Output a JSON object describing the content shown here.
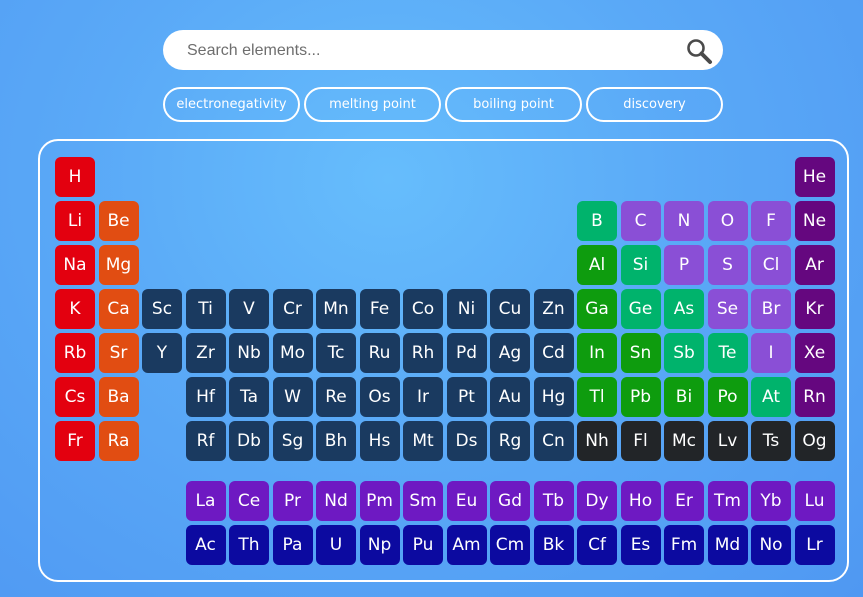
{
  "search": {
    "placeholder": "Search elements..."
  },
  "filters": [
    {
      "label": "electronegativity"
    },
    {
      "label": "melting point"
    },
    {
      "label": "boiling point"
    },
    {
      "label": "discovery"
    }
  ],
  "colors": {
    "alkali": "#e3000f",
    "alkaline_earth": "#e14d12",
    "transition": "#1a3a60",
    "post_transition": "#0e9c0e",
    "metalloid": "#00b36c",
    "nonmetal": "#8a4fd6",
    "noble_gas": "#65077f",
    "unknown": "#222528",
    "lanthanide": "#6e19c2",
    "actinide": "#0c0aa0"
  },
  "elements": [
    {
      "symbol": "H",
      "row": 1,
      "col": 1,
      "category": "alkali"
    },
    {
      "symbol": "He",
      "row": 1,
      "col": 18,
      "category": "noble_gas"
    },
    {
      "symbol": "Li",
      "row": 2,
      "col": 1,
      "category": "alkali"
    },
    {
      "symbol": "Be",
      "row": 2,
      "col": 2,
      "category": "alkaline_earth"
    },
    {
      "symbol": "B",
      "row": 2,
      "col": 13,
      "category": "metalloid"
    },
    {
      "symbol": "C",
      "row": 2,
      "col": 14,
      "category": "nonmetal"
    },
    {
      "symbol": "N",
      "row": 2,
      "col": 15,
      "category": "nonmetal"
    },
    {
      "symbol": "O",
      "row": 2,
      "col": 16,
      "category": "nonmetal"
    },
    {
      "symbol": "F",
      "row": 2,
      "col": 17,
      "category": "nonmetal"
    },
    {
      "symbol": "Ne",
      "row": 2,
      "col": 18,
      "category": "noble_gas"
    },
    {
      "symbol": "Na",
      "row": 3,
      "col": 1,
      "category": "alkali"
    },
    {
      "symbol": "Mg",
      "row": 3,
      "col": 2,
      "category": "alkaline_earth"
    },
    {
      "symbol": "Al",
      "row": 3,
      "col": 13,
      "category": "post_transition"
    },
    {
      "symbol": "Si",
      "row": 3,
      "col": 14,
      "category": "metalloid"
    },
    {
      "symbol": "P",
      "row": 3,
      "col": 15,
      "category": "nonmetal"
    },
    {
      "symbol": "S",
      "row": 3,
      "col": 16,
      "category": "nonmetal"
    },
    {
      "symbol": "Cl",
      "row": 3,
      "col": 17,
      "category": "nonmetal"
    },
    {
      "symbol": "Ar",
      "row": 3,
      "col": 18,
      "category": "noble_gas"
    },
    {
      "symbol": "K",
      "row": 4,
      "col": 1,
      "category": "alkali"
    },
    {
      "symbol": "Ca",
      "row": 4,
      "col": 2,
      "category": "alkaline_earth"
    },
    {
      "symbol": "Sc",
      "row": 4,
      "col": 3,
      "category": "transition"
    },
    {
      "symbol": "Ti",
      "row": 4,
      "col": 4,
      "category": "transition"
    },
    {
      "symbol": "V",
      "row": 4,
      "col": 5,
      "category": "transition"
    },
    {
      "symbol": "Cr",
      "row": 4,
      "col": 6,
      "category": "transition"
    },
    {
      "symbol": "Mn",
      "row": 4,
      "col": 7,
      "category": "transition"
    },
    {
      "symbol": "Fe",
      "row": 4,
      "col": 8,
      "category": "transition"
    },
    {
      "symbol": "Co",
      "row": 4,
      "col": 9,
      "category": "transition"
    },
    {
      "symbol": "Ni",
      "row": 4,
      "col": 10,
      "category": "transition"
    },
    {
      "symbol": "Cu",
      "row": 4,
      "col": 11,
      "category": "transition"
    },
    {
      "symbol": "Zn",
      "row": 4,
      "col": 12,
      "category": "transition"
    },
    {
      "symbol": "Ga",
      "row": 4,
      "col": 13,
      "category": "post_transition"
    },
    {
      "symbol": "Ge",
      "row": 4,
      "col": 14,
      "category": "metalloid"
    },
    {
      "symbol": "As",
      "row": 4,
      "col": 15,
      "category": "metalloid"
    },
    {
      "symbol": "Se",
      "row": 4,
      "col": 16,
      "category": "nonmetal"
    },
    {
      "symbol": "Br",
      "row": 4,
      "col": 17,
      "category": "nonmetal"
    },
    {
      "symbol": "Kr",
      "row": 4,
      "col": 18,
      "category": "noble_gas"
    },
    {
      "symbol": "Rb",
      "row": 5,
      "col": 1,
      "category": "alkali"
    },
    {
      "symbol": "Sr",
      "row": 5,
      "col": 2,
      "category": "alkaline_earth"
    },
    {
      "symbol": "Y",
      "row": 5,
      "col": 3,
      "category": "transition"
    },
    {
      "symbol": "Zr",
      "row": 5,
      "col": 4,
      "category": "transition"
    },
    {
      "symbol": "Nb",
      "row": 5,
      "col": 5,
      "category": "transition"
    },
    {
      "symbol": "Mo",
      "row": 5,
      "col": 6,
      "category": "transition"
    },
    {
      "symbol": "Tc",
      "row": 5,
      "col": 7,
      "category": "transition"
    },
    {
      "symbol": "Ru",
      "row": 5,
      "col": 8,
      "category": "transition"
    },
    {
      "symbol": "Rh",
      "row": 5,
      "col": 9,
      "category": "transition"
    },
    {
      "symbol": "Pd",
      "row": 5,
      "col": 10,
      "category": "transition"
    },
    {
      "symbol": "Ag",
      "row": 5,
      "col": 11,
      "category": "transition"
    },
    {
      "symbol": "Cd",
      "row": 5,
      "col": 12,
      "category": "transition"
    },
    {
      "symbol": "In",
      "row": 5,
      "col": 13,
      "category": "post_transition"
    },
    {
      "symbol": "Sn",
      "row": 5,
      "col": 14,
      "category": "post_transition"
    },
    {
      "symbol": "Sb",
      "row": 5,
      "col": 15,
      "category": "metalloid"
    },
    {
      "symbol": "Te",
      "row": 5,
      "col": 16,
      "category": "metalloid"
    },
    {
      "symbol": "I",
      "row": 5,
      "col": 17,
      "category": "nonmetal"
    },
    {
      "symbol": "Xe",
      "row": 5,
      "col": 18,
      "category": "noble_gas"
    },
    {
      "symbol": "Cs",
      "row": 6,
      "col": 1,
      "category": "alkali"
    },
    {
      "symbol": "Ba",
      "row": 6,
      "col": 2,
      "category": "alkaline_earth"
    },
    {
      "symbol": "Hf",
      "row": 6,
      "col": 4,
      "category": "transition"
    },
    {
      "symbol": "Ta",
      "row": 6,
      "col": 5,
      "category": "transition"
    },
    {
      "symbol": "W",
      "row": 6,
      "col": 6,
      "category": "transition"
    },
    {
      "symbol": "Re",
      "row": 6,
      "col": 7,
      "category": "transition"
    },
    {
      "symbol": "Os",
      "row": 6,
      "col": 8,
      "category": "transition"
    },
    {
      "symbol": "Ir",
      "row": 6,
      "col": 9,
      "category": "transition"
    },
    {
      "symbol": "Pt",
      "row": 6,
      "col": 10,
      "category": "transition"
    },
    {
      "symbol": "Au",
      "row": 6,
      "col": 11,
      "category": "transition"
    },
    {
      "symbol": "Hg",
      "row": 6,
      "col": 12,
      "category": "transition"
    },
    {
      "symbol": "Tl",
      "row": 6,
      "col": 13,
      "category": "post_transition"
    },
    {
      "symbol": "Pb",
      "row": 6,
      "col": 14,
      "category": "post_transition"
    },
    {
      "symbol": "Bi",
      "row": 6,
      "col": 15,
      "category": "post_transition"
    },
    {
      "symbol": "Po",
      "row": 6,
      "col": 16,
      "category": "post_transition"
    },
    {
      "symbol": "At",
      "row": 6,
      "col": 17,
      "category": "metalloid"
    },
    {
      "symbol": "Rn",
      "row": 6,
      "col": 18,
      "category": "noble_gas"
    },
    {
      "symbol": "Fr",
      "row": 7,
      "col": 1,
      "category": "alkali"
    },
    {
      "symbol": "Ra",
      "row": 7,
      "col": 2,
      "category": "alkaline_earth"
    },
    {
      "symbol": "Rf",
      "row": 7,
      "col": 4,
      "category": "transition"
    },
    {
      "symbol": "Db",
      "row": 7,
      "col": 5,
      "category": "transition"
    },
    {
      "symbol": "Sg",
      "row": 7,
      "col": 6,
      "category": "transition"
    },
    {
      "symbol": "Bh",
      "row": 7,
      "col": 7,
      "category": "transition"
    },
    {
      "symbol": "Hs",
      "row": 7,
      "col": 8,
      "category": "transition"
    },
    {
      "symbol": "Mt",
      "row": 7,
      "col": 9,
      "category": "transition"
    },
    {
      "symbol": "Ds",
      "row": 7,
      "col": 10,
      "category": "transition"
    },
    {
      "symbol": "Rg",
      "row": 7,
      "col": 11,
      "category": "transition"
    },
    {
      "symbol": "Cn",
      "row": 7,
      "col": 12,
      "category": "transition"
    },
    {
      "symbol": "Nh",
      "row": 7,
      "col": 13,
      "category": "unknown"
    },
    {
      "symbol": "Fl",
      "row": 7,
      "col": 14,
      "category": "unknown"
    },
    {
      "symbol": "Mc",
      "row": 7,
      "col": 15,
      "category": "unknown"
    },
    {
      "symbol": "Lv",
      "row": 7,
      "col": 16,
      "category": "unknown"
    },
    {
      "symbol": "Ts",
      "row": 7,
      "col": 17,
      "category": "unknown"
    },
    {
      "symbol": "Og",
      "row": 7,
      "col": 18,
      "category": "unknown"
    },
    {
      "symbol": "La",
      "row": 9,
      "col": 4,
      "category": "lanthanide"
    },
    {
      "symbol": "Ce",
      "row": 9,
      "col": 5,
      "category": "lanthanide"
    },
    {
      "symbol": "Pr",
      "row": 9,
      "col": 6,
      "category": "lanthanide"
    },
    {
      "symbol": "Nd",
      "row": 9,
      "col": 7,
      "category": "lanthanide"
    },
    {
      "symbol": "Pm",
      "row": 9,
      "col": 8,
      "category": "lanthanide"
    },
    {
      "symbol": "Sm",
      "row": 9,
      "col": 9,
      "category": "lanthanide"
    },
    {
      "symbol": "Eu",
      "row": 9,
      "col": 10,
      "category": "lanthanide"
    },
    {
      "symbol": "Gd",
      "row": 9,
      "col": 11,
      "category": "lanthanide"
    },
    {
      "symbol": "Tb",
      "row": 9,
      "col": 12,
      "category": "lanthanide"
    },
    {
      "symbol": "Dy",
      "row": 9,
      "col": 13,
      "category": "lanthanide"
    },
    {
      "symbol": "Ho",
      "row": 9,
      "col": 14,
      "category": "lanthanide"
    },
    {
      "symbol": "Er",
      "row": 9,
      "col": 15,
      "category": "lanthanide"
    },
    {
      "symbol": "Tm",
      "row": 9,
      "col": 16,
      "category": "lanthanide"
    },
    {
      "symbol": "Yb",
      "row": 9,
      "col": 17,
      "category": "lanthanide"
    },
    {
      "symbol": "Lu",
      "row": 9,
      "col": 18,
      "category": "lanthanide"
    },
    {
      "symbol": "Ac",
      "row": 10,
      "col": 4,
      "category": "actinide"
    },
    {
      "symbol": "Th",
      "row": 10,
      "col": 5,
      "category": "actinide"
    },
    {
      "symbol": "Pa",
      "row": 10,
      "col": 6,
      "category": "actinide"
    },
    {
      "symbol": "U",
      "row": 10,
      "col": 7,
      "category": "actinide"
    },
    {
      "symbol": "Np",
      "row": 10,
      "col": 8,
      "category": "actinide"
    },
    {
      "symbol": "Pu",
      "row": 10,
      "col": 9,
      "category": "actinide"
    },
    {
      "symbol": "Am",
      "row": 10,
      "col": 10,
      "category": "actinide"
    },
    {
      "symbol": "Cm",
      "row": 10,
      "col": 11,
      "category": "actinide"
    },
    {
      "symbol": "Bk",
      "row": 10,
      "col": 12,
      "category": "actinide"
    },
    {
      "symbol": "Cf",
      "row": 10,
      "col": 13,
      "category": "actinide"
    },
    {
      "symbol": "Es",
      "row": 10,
      "col": 14,
      "category": "actinide"
    },
    {
      "symbol": "Fm",
      "row": 10,
      "col": 15,
      "category": "actinide"
    },
    {
      "symbol": "Md",
      "row": 10,
      "col": 16,
      "category": "actinide"
    },
    {
      "symbol": "No",
      "row": 10,
      "col": 17,
      "category": "actinide"
    },
    {
      "symbol": "Lr",
      "row": 10,
      "col": 18,
      "category": "actinide"
    }
  ]
}
